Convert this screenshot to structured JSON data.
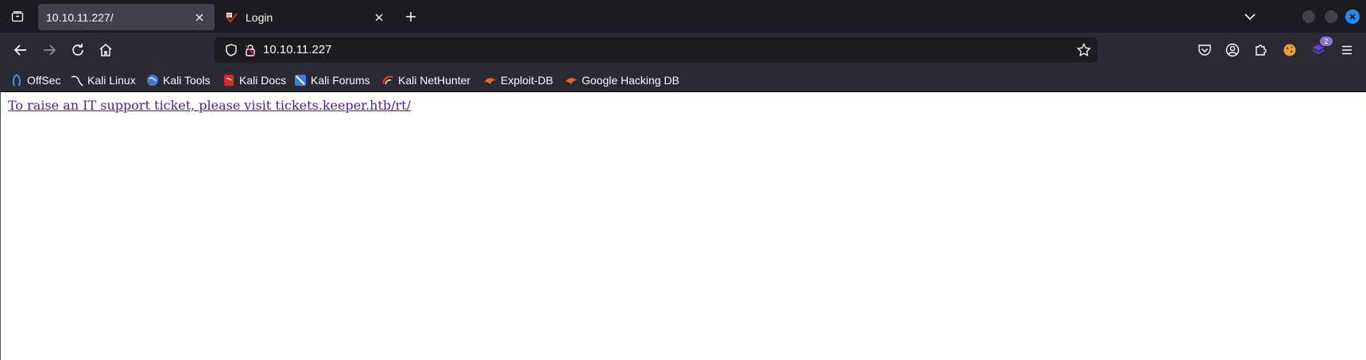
{
  "tabs": [
    {
      "title": "10.10.11.227/",
      "active": true
    },
    {
      "title": "Login",
      "active": false
    }
  ],
  "icons": {
    "tab_list": "tab-list-icon",
    "close": "close-icon",
    "new_tab": "plus-icon",
    "list_all": "chevron-down-icon",
    "back": "back-arrow-icon",
    "forward": "forward-arrow-icon",
    "reload": "reload-icon",
    "home": "home-icon",
    "shield": "shield-icon",
    "lock": "lock-icon",
    "star": "star-icon",
    "pocket": "pocket-icon",
    "account": "account-icon",
    "extensions": "puzzle-icon",
    "menu": "hamburger-menu-icon"
  },
  "urlbar": {
    "url": "10.10.11.227"
  },
  "toolbar": {
    "extension_badge": "2"
  },
  "bookmarks": [
    {
      "label": "OffSec"
    },
    {
      "label": "Kali Linux"
    },
    {
      "label": "Kali Tools"
    },
    {
      "label": "Kali Docs"
    },
    {
      "label": "Kali Forums"
    },
    {
      "label": "Kali NetHunter"
    },
    {
      "label": "Exploit-DB"
    },
    {
      "label": "Google Hacking DB"
    }
  ],
  "page": {
    "link_text": "To raise an IT support ticket, please visit tickets.keeper.htb/rt/"
  },
  "colors": {
    "tabstrip_bg": "#1c1b22",
    "toolbar_bg": "#2b2a33",
    "active_tab_bg": "#42414d",
    "visited_link": "#551a8b",
    "window_close": "#1f8cf0"
  }
}
